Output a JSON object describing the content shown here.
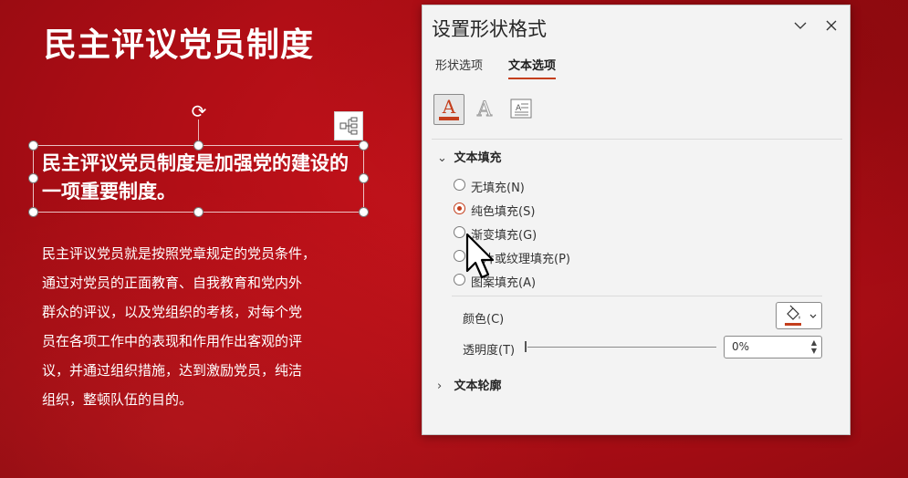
{
  "slide": {
    "title": "民主评议党员制度",
    "selected_text": "民主评议党员制度是加强党的建设的一项重要制度。",
    "body_lines": [
      "民主评议党员就是按照党章规定的党员条件，",
      "通过对党员的正面教育、自我教育和党内外",
      "群众的评议，以及党组织的考核，对每个党",
      "员在各项工作中的表现和作用作出客观的评",
      "议，并通过组织措施，达到激励党员，纯洁",
      "组织，整顿队伍的目的。"
    ]
  },
  "pane": {
    "title": "设置形状格式",
    "tabs": [
      {
        "label": "形状选项",
        "active": false
      },
      {
        "label": "文本选项",
        "active": true
      }
    ],
    "category_icons": [
      "text-fill-outline-icon",
      "text-effects-icon",
      "textbox-icon"
    ],
    "text_fill": {
      "header": "文本填充",
      "options": [
        {
          "label": "无填充(N)",
          "checked": false
        },
        {
          "label": "纯色填充(S)",
          "checked": true
        },
        {
          "label": "渐变填充(G)",
          "checked": false
        },
        {
          "label": "图片或纹理填充(P)",
          "checked": false
        },
        {
          "label": "图案填充(A)",
          "checked": false
        }
      ],
      "color_label": "颜色(C)",
      "transparency_label": "透明度(T)",
      "transparency_value": "0%",
      "transparency_level": 0
    },
    "text_outline": {
      "header": "文本轮廓"
    }
  },
  "colors": {
    "slide_red": "#b20e16",
    "accent": "#c43e1c",
    "fill_color": "#c43e1c"
  }
}
